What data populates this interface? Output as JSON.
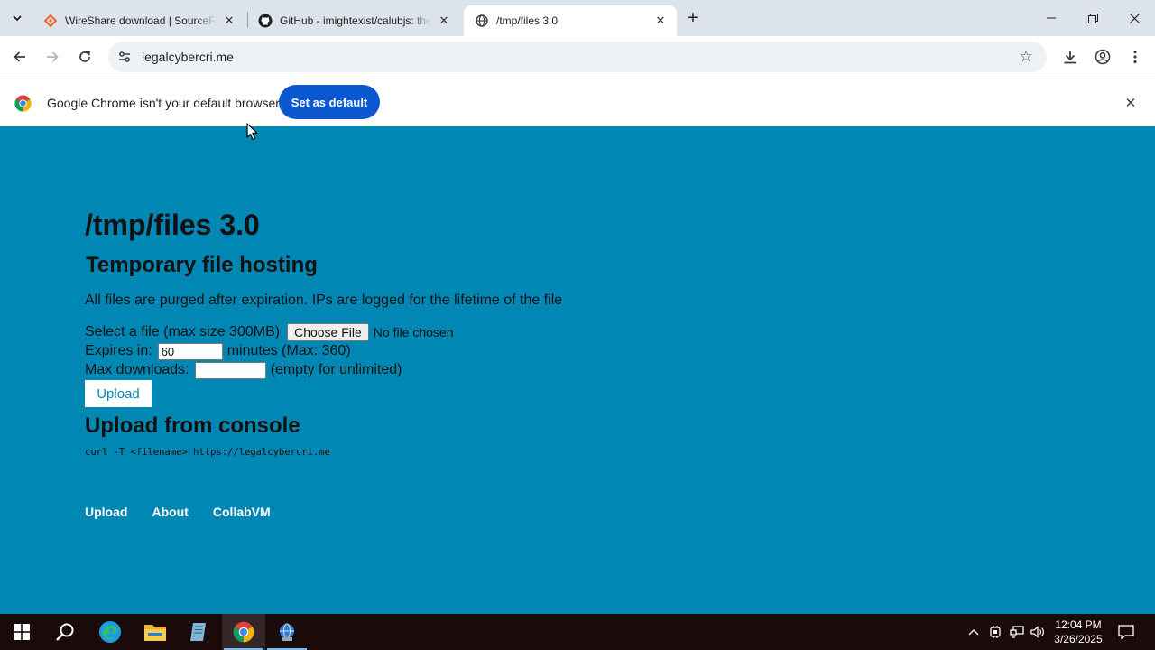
{
  "browser": {
    "tabs": [
      {
        "title": "WireShare download | SourceForge.net",
        "icon": "sourceforge-icon"
      },
      {
        "title": "GitHub - imightexist/calubjs: the",
        "icon": "github-icon"
      },
      {
        "title": "/tmp/files 3.0",
        "icon": "globe-icon"
      }
    ],
    "address": "legalcybercri.me",
    "infobar_text": "Google Chrome isn't your default browser",
    "infobar_button": "Set as default"
  },
  "page": {
    "title": "/tmp/files 3.0",
    "subtitle": "Temporary file hosting",
    "notice": "All files are purged after expiration. IPs are logged for the lifetime of the file",
    "form": {
      "file_label": "Select a file (max size 300MB)",
      "file_button": "Choose File",
      "file_status": "No file chosen",
      "expires_label": "Expires in:",
      "expires_value": "60",
      "expires_suffix": "minutes (Max: 360)",
      "maxdl_label": "Max downloads:",
      "maxdl_value": "",
      "maxdl_suffix": "(empty for unlimited)",
      "upload_button": "Upload"
    },
    "console_heading": "Upload from console",
    "console_command": "curl -T <filename> https://legalcybercri.me",
    "footer_links": [
      "Upload",
      "About",
      "CollabVM"
    ]
  },
  "taskbar": {
    "apps": [
      "start",
      "search",
      "edge",
      "file-explorer",
      "notepad",
      "chrome",
      "network-app"
    ],
    "time": "12:04 PM",
    "date": "3/26/2025"
  }
}
